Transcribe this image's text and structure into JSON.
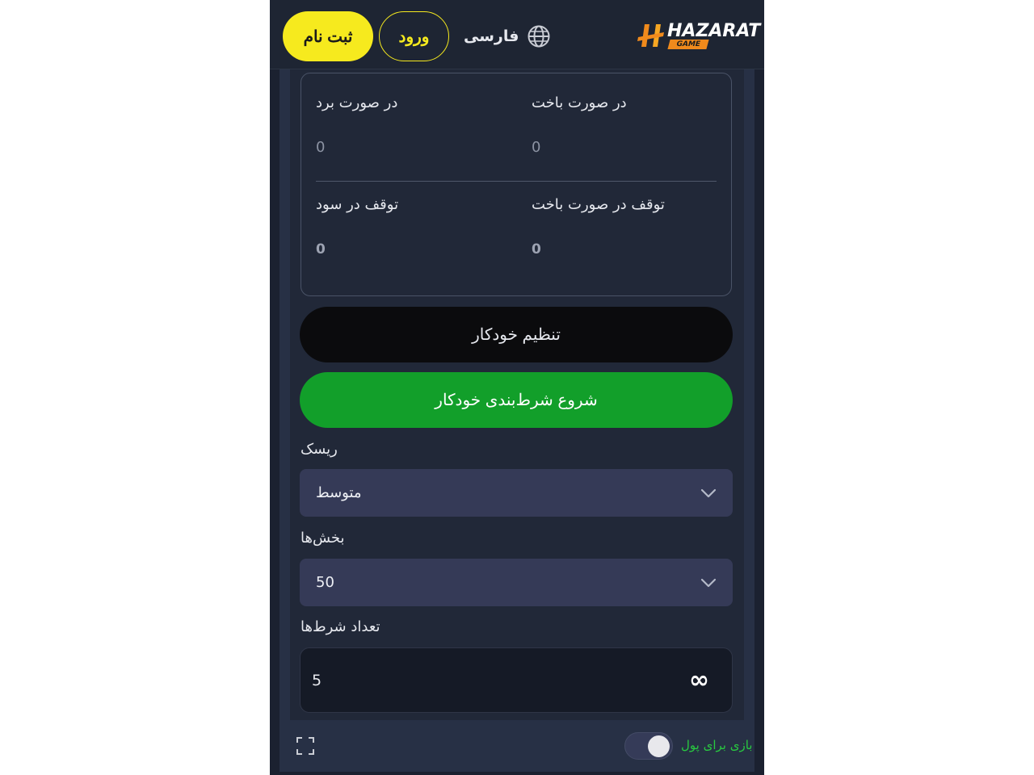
{
  "header": {
    "register_label": "ثبت نام",
    "login_label": "ورود",
    "language_label": "فارسی",
    "logo_text": "HAZARAT",
    "logo_sub": "GAME"
  },
  "auto_settings": {
    "on_win_label": "در صورت برد",
    "on_win_value": "0",
    "on_loss_label": "در صورت باخت",
    "on_loss_value": "0",
    "stop_profit_label": "توقف در سود",
    "stop_profit_value": "0",
    "stop_loss_label": "توقف در صورت باخت",
    "stop_loss_value": "0"
  },
  "buttons": {
    "auto_setup": "تنظیم خودکار",
    "start_auto": "شروع شرط‌بندی خودکار"
  },
  "risk": {
    "label": "ریسک",
    "value": "متوسط"
  },
  "segments": {
    "label": "بخش‌ها",
    "value": "50"
  },
  "bets": {
    "label": "تعداد شرط‌ها",
    "value": "5",
    "infinity": "∞"
  },
  "footer": {
    "real_money_label": "بازی برای پول",
    "toggle_on": true
  },
  "colors": {
    "accent_yellow": "#f6ea1e",
    "start_green": "#129f2a",
    "real_money_green": "#28c840"
  }
}
